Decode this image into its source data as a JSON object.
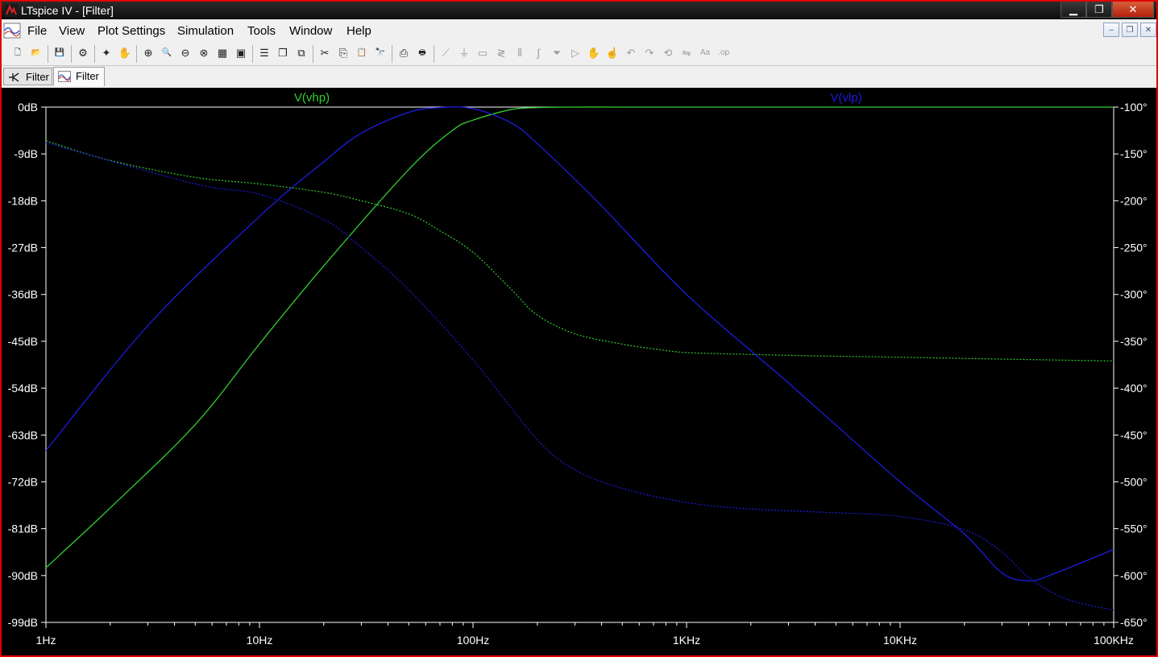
{
  "window": {
    "title": "LTspice IV - [Filter]",
    "buttons": {
      "minimize": "▁",
      "maximize": "❐",
      "close": "✕"
    }
  },
  "menu": {
    "items": [
      "File",
      "View",
      "Plot Settings",
      "Simulation",
      "Tools",
      "Window",
      "Help"
    ],
    "mdi_buttons": {
      "minimize": "–",
      "restore": "❐",
      "close": "✕"
    }
  },
  "toolbar": {
    "icons": [
      {
        "name": "new-schematic-icon",
        "glyph": "🗋"
      },
      {
        "name": "open-icon",
        "glyph": "📂"
      },
      {
        "name": "save-icon",
        "glyph": "💾"
      },
      {
        "name": "control-panel-icon",
        "glyph": "⚙"
      },
      {
        "name": "run-icon",
        "glyph": "✦"
      },
      {
        "name": "pan-hand-icon",
        "glyph": "✋"
      },
      {
        "name": "zoom-in-icon",
        "glyph": "⊕"
      },
      {
        "name": "zoom-area-icon",
        "glyph": "🔍"
      },
      {
        "name": "zoom-out-icon",
        "glyph": "⊖"
      },
      {
        "name": "zoom-cancel-icon",
        "glyph": "⊗"
      },
      {
        "name": "autorange-icon",
        "glyph": "▦"
      },
      {
        "name": "fit-icon",
        "glyph": "▣"
      },
      {
        "name": "tile-horizontal-icon",
        "glyph": "☰"
      },
      {
        "name": "cascade-icon",
        "glyph": "❐"
      },
      {
        "name": "tile-vertical-icon",
        "glyph": "⧉"
      },
      {
        "name": "cut-icon",
        "glyph": "✂"
      },
      {
        "name": "copy-icon",
        "glyph": "⎘"
      },
      {
        "name": "paste-icon",
        "glyph": "📋"
      },
      {
        "name": "find-icon",
        "glyph": "🔭"
      },
      {
        "name": "print-preview-icon",
        "glyph": "⎙"
      },
      {
        "name": "print-icon",
        "glyph": "🖶"
      },
      {
        "name": "wire-icon",
        "glyph": "⟋"
      },
      {
        "name": "ground-icon",
        "glyph": "⏚"
      },
      {
        "name": "label-icon",
        "glyph": "▭"
      },
      {
        "name": "resistor-icon",
        "glyph": "≷"
      },
      {
        "name": "capacitor-icon",
        "glyph": "⫴"
      },
      {
        "name": "inductor-icon",
        "glyph": "∫"
      },
      {
        "name": "diode-icon",
        "glyph": "⏷"
      },
      {
        "name": "component-icon",
        "glyph": "▷"
      },
      {
        "name": "move-icon",
        "glyph": "✋"
      },
      {
        "name": "drag-icon",
        "glyph": "☝"
      },
      {
        "name": "undo-icon",
        "glyph": "↶"
      },
      {
        "name": "redo-icon",
        "glyph": "↷"
      },
      {
        "name": "rotate-icon",
        "glyph": "⟲"
      },
      {
        "name": "mirror-icon",
        "glyph": "⇋"
      },
      {
        "name": "text-icon",
        "glyph": "Aa"
      },
      {
        "name": "spice-directive-icon",
        "glyph": ".op"
      }
    ]
  },
  "tabs": [
    {
      "label": "Filter",
      "kind": "schematic"
    },
    {
      "label": "Filter",
      "kind": "waveform"
    }
  ],
  "colors": {
    "vhp": "#32cd32",
    "vlp": "#1c1ce0",
    "axis": "#ffffff",
    "plot_bg": "#000000"
  },
  "chart_data": {
    "type": "line",
    "x_scale": "log",
    "xlim": [
      1,
      100000
    ],
    "x_ticks": [
      {
        "value": 1,
        "label": "1Hz"
      },
      {
        "value": 10,
        "label": "10Hz"
      },
      {
        "value": 100,
        "label": "100Hz"
      },
      {
        "value": 1000,
        "label": "1KHz"
      },
      {
        "value": 10000,
        "label": "10KHz"
      },
      {
        "value": 100000,
        "label": "100KHz"
      }
    ],
    "y_left": {
      "lim": [
        -99,
        0
      ],
      "ticks": [
        {
          "value": 0,
          "label": "0dB"
        },
        {
          "value": -9,
          "label": "-9dB"
        },
        {
          "value": -18,
          "label": "-18dB"
        },
        {
          "value": -27,
          "label": "-27dB"
        },
        {
          "value": -36,
          "label": "-36dB"
        },
        {
          "value": -45,
          "label": "-45dB"
        },
        {
          "value": -54,
          "label": "-54dB"
        },
        {
          "value": -63,
          "label": "-63dB"
        },
        {
          "value": -72,
          "label": "-72dB"
        },
        {
          "value": -81,
          "label": "-81dB"
        },
        {
          "value": -90,
          "label": "-90dB"
        },
        {
          "value": -99,
          "label": "-99dB"
        }
      ]
    },
    "y_right": {
      "lim": [
        -650,
        -100
      ],
      "ticks": [
        {
          "value": -100,
          "label": "-100°"
        },
        {
          "value": -150,
          "label": "-150°"
        },
        {
          "value": -200,
          "label": "-200°"
        },
        {
          "value": -250,
          "label": "-250°"
        },
        {
          "value": -300,
          "label": "-300°"
        },
        {
          "value": -350,
          "label": "-350°"
        },
        {
          "value": -400,
          "label": "-400°"
        },
        {
          "value": -450,
          "label": "-450°"
        },
        {
          "value": -500,
          "label": "-500°"
        },
        {
          "value": -550,
          "label": "-550°"
        },
        {
          "value": -600,
          "label": "-600°"
        },
        {
          "value": -650,
          "label": "-650°"
        }
      ]
    },
    "grid": false,
    "legend_placement": "top",
    "series": [
      {
        "name": "V(vhp)",
        "color": "#32cd32",
        "magnitude_db": [
          [
            1,
            -88.5
          ],
          [
            2,
            -77
          ],
          [
            5,
            -61
          ],
          [
            10,
            -45.5
          ],
          [
            20,
            -30.5
          ],
          [
            50,
            -12
          ],
          [
            80,
            -4.5
          ],
          [
            100,
            -2.5
          ],
          [
            150,
            -0.5
          ],
          [
            200,
            -0.1
          ],
          [
            300,
            0
          ],
          [
            1000,
            0
          ],
          [
            100000,
            0
          ]
        ],
        "phase_deg": [
          [
            1,
            -136
          ],
          [
            2,
            -157
          ],
          [
            5,
            -175
          ],
          [
            10,
            -182
          ],
          [
            20,
            -191
          ],
          [
            30,
            -200
          ],
          [
            50,
            -214
          ],
          [
            70,
            -232
          ],
          [
            100,
            -255
          ],
          [
            150,
            -294
          ],
          [
            200,
            -322
          ],
          [
            300,
            -342
          ],
          [
            500,
            -353
          ],
          [
            700,
            -358
          ],
          [
            1000,
            -362
          ],
          [
            2000,
            -364
          ],
          [
            5000,
            -366
          ],
          [
            10000,
            -367
          ],
          [
            30000,
            -369
          ],
          [
            100000,
            -371
          ]
        ]
      },
      {
        "name": "V(vlp)",
        "color": "#1c1ce0",
        "magnitude_db": [
          [
            1,
            -66
          ],
          [
            3,
            -42
          ],
          [
            10,
            -21
          ],
          [
            20,
            -10.5
          ],
          [
            30,
            -5
          ],
          [
            50,
            -1
          ],
          [
            70,
            -0.1
          ],
          [
            100,
            -0.3
          ],
          [
            150,
            -3
          ],
          [
            200,
            -7
          ],
          [
            400,
            -19
          ],
          [
            1000,
            -36
          ],
          [
            3000,
            -53
          ],
          [
            10000,
            -72
          ],
          [
            20000,
            -82
          ],
          [
            30000,
            -89.5
          ],
          [
            40000,
            -91
          ],
          [
            50000,
            -90
          ],
          [
            100000,
            -85
          ]
        ],
        "phase_deg": [
          [
            1,
            -138
          ],
          [
            5,
            -182
          ],
          [
            10,
            -193
          ],
          [
            20,
            -220
          ],
          [
            30,
            -250
          ],
          [
            50,
            -295
          ],
          [
            100,
            -370
          ],
          [
            200,
            -455
          ],
          [
            300,
            -487
          ],
          [
            500,
            -507
          ],
          [
            1000,
            -522
          ],
          [
            2000,
            -529
          ],
          [
            5000,
            -533
          ],
          [
            10000,
            -537
          ],
          [
            20000,
            -551
          ],
          [
            30000,
            -575
          ],
          [
            40000,
            -602
          ],
          [
            60000,
            -625
          ],
          [
            100000,
            -637
          ]
        ]
      }
    ]
  }
}
